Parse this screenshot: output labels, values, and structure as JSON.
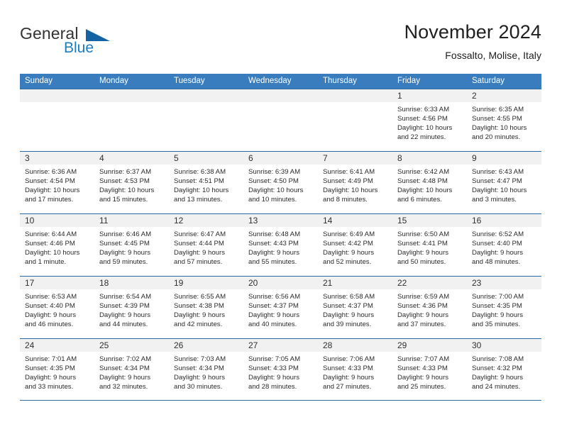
{
  "brand": {
    "name_part1": "General",
    "name_part2": "Blue",
    "logo_icon": "blue-triangle-icon"
  },
  "header": {
    "title": "November 2024",
    "subtitle": "Fossalto, Molise, Italy"
  },
  "colors": {
    "header_blue": "#3a7dbf",
    "row_border_blue": "#2e6da4",
    "brand_blue": "#1a7cc4",
    "day_band_gray": "#f1f1f1"
  },
  "weekdays": [
    "Sunday",
    "Monday",
    "Tuesday",
    "Wednesday",
    "Thursday",
    "Friday",
    "Saturday"
  ],
  "weeks": [
    [
      {
        "day": "",
        "empty": true
      },
      {
        "day": "",
        "empty": true
      },
      {
        "day": "",
        "empty": true
      },
      {
        "day": "",
        "empty": true
      },
      {
        "day": "",
        "empty": true
      },
      {
        "day": "1",
        "sunrise": "Sunrise: 6:33 AM",
        "sunset": "Sunset: 4:56 PM",
        "daylight_line1": "Daylight: 10 hours",
        "daylight_line2": "and 22 minutes."
      },
      {
        "day": "2",
        "sunrise": "Sunrise: 6:35 AM",
        "sunset": "Sunset: 4:55 PM",
        "daylight_line1": "Daylight: 10 hours",
        "daylight_line2": "and 20 minutes."
      }
    ],
    [
      {
        "day": "3",
        "sunrise": "Sunrise: 6:36 AM",
        "sunset": "Sunset: 4:54 PM",
        "daylight_line1": "Daylight: 10 hours",
        "daylight_line2": "and 17 minutes."
      },
      {
        "day": "4",
        "sunrise": "Sunrise: 6:37 AM",
        "sunset": "Sunset: 4:53 PM",
        "daylight_line1": "Daylight: 10 hours",
        "daylight_line2": "and 15 minutes."
      },
      {
        "day": "5",
        "sunrise": "Sunrise: 6:38 AM",
        "sunset": "Sunset: 4:51 PM",
        "daylight_line1": "Daylight: 10 hours",
        "daylight_line2": "and 13 minutes."
      },
      {
        "day": "6",
        "sunrise": "Sunrise: 6:39 AM",
        "sunset": "Sunset: 4:50 PM",
        "daylight_line1": "Daylight: 10 hours",
        "daylight_line2": "and 10 minutes."
      },
      {
        "day": "7",
        "sunrise": "Sunrise: 6:41 AM",
        "sunset": "Sunset: 4:49 PM",
        "daylight_line1": "Daylight: 10 hours",
        "daylight_line2": "and 8 minutes."
      },
      {
        "day": "8",
        "sunrise": "Sunrise: 6:42 AM",
        "sunset": "Sunset: 4:48 PM",
        "daylight_line1": "Daylight: 10 hours",
        "daylight_line2": "and 6 minutes."
      },
      {
        "day": "9",
        "sunrise": "Sunrise: 6:43 AM",
        "sunset": "Sunset: 4:47 PM",
        "daylight_line1": "Daylight: 10 hours",
        "daylight_line2": "and 3 minutes."
      }
    ],
    [
      {
        "day": "10",
        "sunrise": "Sunrise: 6:44 AM",
        "sunset": "Sunset: 4:46 PM",
        "daylight_line1": "Daylight: 10 hours",
        "daylight_line2": "and 1 minute."
      },
      {
        "day": "11",
        "sunrise": "Sunrise: 6:46 AM",
        "sunset": "Sunset: 4:45 PM",
        "daylight_line1": "Daylight: 9 hours",
        "daylight_line2": "and 59 minutes."
      },
      {
        "day": "12",
        "sunrise": "Sunrise: 6:47 AM",
        "sunset": "Sunset: 4:44 PM",
        "daylight_line1": "Daylight: 9 hours",
        "daylight_line2": "and 57 minutes."
      },
      {
        "day": "13",
        "sunrise": "Sunrise: 6:48 AM",
        "sunset": "Sunset: 4:43 PM",
        "daylight_line1": "Daylight: 9 hours",
        "daylight_line2": "and 55 minutes."
      },
      {
        "day": "14",
        "sunrise": "Sunrise: 6:49 AM",
        "sunset": "Sunset: 4:42 PM",
        "daylight_line1": "Daylight: 9 hours",
        "daylight_line2": "and 52 minutes."
      },
      {
        "day": "15",
        "sunrise": "Sunrise: 6:50 AM",
        "sunset": "Sunset: 4:41 PM",
        "daylight_line1": "Daylight: 9 hours",
        "daylight_line2": "and 50 minutes."
      },
      {
        "day": "16",
        "sunrise": "Sunrise: 6:52 AM",
        "sunset": "Sunset: 4:40 PM",
        "daylight_line1": "Daylight: 9 hours",
        "daylight_line2": "and 48 minutes."
      }
    ],
    [
      {
        "day": "17",
        "sunrise": "Sunrise: 6:53 AM",
        "sunset": "Sunset: 4:40 PM",
        "daylight_line1": "Daylight: 9 hours",
        "daylight_line2": "and 46 minutes."
      },
      {
        "day": "18",
        "sunrise": "Sunrise: 6:54 AM",
        "sunset": "Sunset: 4:39 PM",
        "daylight_line1": "Daylight: 9 hours",
        "daylight_line2": "and 44 minutes."
      },
      {
        "day": "19",
        "sunrise": "Sunrise: 6:55 AM",
        "sunset": "Sunset: 4:38 PM",
        "daylight_line1": "Daylight: 9 hours",
        "daylight_line2": "and 42 minutes."
      },
      {
        "day": "20",
        "sunrise": "Sunrise: 6:56 AM",
        "sunset": "Sunset: 4:37 PM",
        "daylight_line1": "Daylight: 9 hours",
        "daylight_line2": "and 40 minutes."
      },
      {
        "day": "21",
        "sunrise": "Sunrise: 6:58 AM",
        "sunset": "Sunset: 4:37 PM",
        "daylight_line1": "Daylight: 9 hours",
        "daylight_line2": "and 39 minutes."
      },
      {
        "day": "22",
        "sunrise": "Sunrise: 6:59 AM",
        "sunset": "Sunset: 4:36 PM",
        "daylight_line1": "Daylight: 9 hours",
        "daylight_line2": "and 37 minutes."
      },
      {
        "day": "23",
        "sunrise": "Sunrise: 7:00 AM",
        "sunset": "Sunset: 4:35 PM",
        "daylight_line1": "Daylight: 9 hours",
        "daylight_line2": "and 35 minutes."
      }
    ],
    [
      {
        "day": "24",
        "sunrise": "Sunrise: 7:01 AM",
        "sunset": "Sunset: 4:35 PM",
        "daylight_line1": "Daylight: 9 hours",
        "daylight_line2": "and 33 minutes."
      },
      {
        "day": "25",
        "sunrise": "Sunrise: 7:02 AM",
        "sunset": "Sunset: 4:34 PM",
        "daylight_line1": "Daylight: 9 hours",
        "daylight_line2": "and 32 minutes."
      },
      {
        "day": "26",
        "sunrise": "Sunrise: 7:03 AM",
        "sunset": "Sunset: 4:34 PM",
        "daylight_line1": "Daylight: 9 hours",
        "daylight_line2": "and 30 minutes."
      },
      {
        "day": "27",
        "sunrise": "Sunrise: 7:05 AM",
        "sunset": "Sunset: 4:33 PM",
        "daylight_line1": "Daylight: 9 hours",
        "daylight_line2": "and 28 minutes."
      },
      {
        "day": "28",
        "sunrise": "Sunrise: 7:06 AM",
        "sunset": "Sunset: 4:33 PM",
        "daylight_line1": "Daylight: 9 hours",
        "daylight_line2": "and 27 minutes."
      },
      {
        "day": "29",
        "sunrise": "Sunrise: 7:07 AM",
        "sunset": "Sunset: 4:33 PM",
        "daylight_line1": "Daylight: 9 hours",
        "daylight_line2": "and 25 minutes."
      },
      {
        "day": "30",
        "sunrise": "Sunrise: 7:08 AM",
        "sunset": "Sunset: 4:32 PM",
        "daylight_line1": "Daylight: 9 hours",
        "daylight_line2": "and 24 minutes."
      }
    ]
  ]
}
